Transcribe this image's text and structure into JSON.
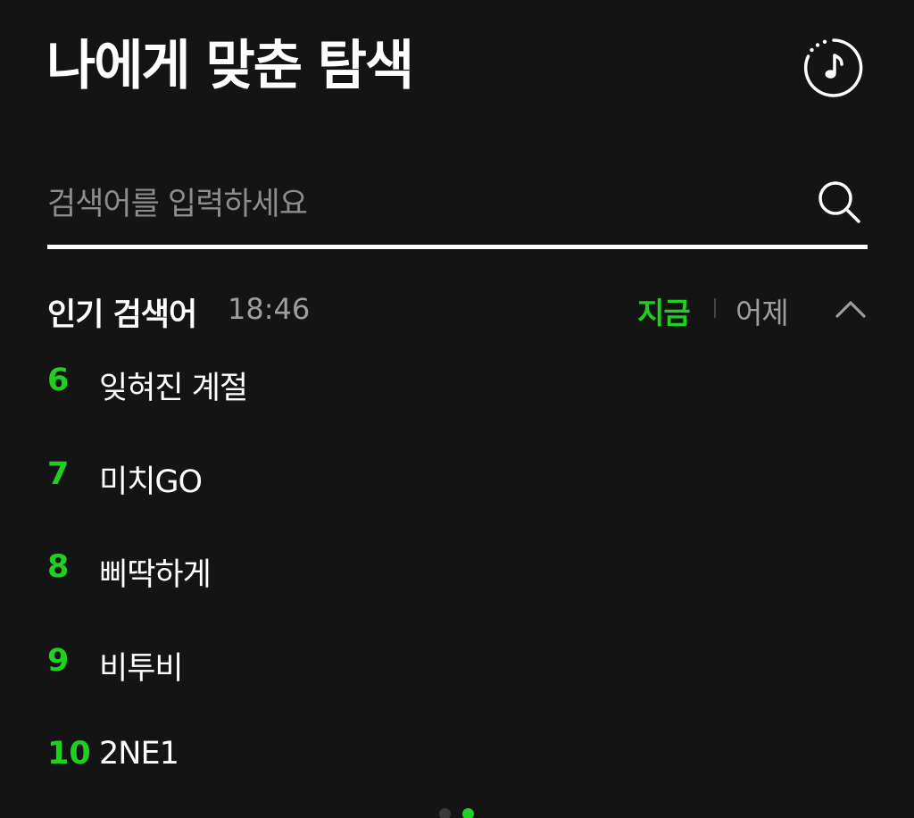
{
  "header": {
    "title": "나에게 맞춘 탐색",
    "music_icon": "music-note-circle-icon"
  },
  "search": {
    "placeholder": "검색어를 입력하세요",
    "value": "",
    "icon": "search-icon"
  },
  "popular": {
    "title": "인기 검색어",
    "time": "18:46",
    "tab_now": "지금",
    "tab_yesterday": "어제",
    "active_tab": "지금",
    "collapse_icon": "chevron-up-icon",
    "items": [
      {
        "rank": "6",
        "text": "잊혀진 계절"
      },
      {
        "rank": "7",
        "text": "미치GO"
      },
      {
        "rank": "8",
        "text": "삐딱하게"
      },
      {
        "rank": "9",
        "text": "비투비"
      },
      {
        "rank": "10",
        "text": "2NE1"
      }
    ]
  },
  "pager": {
    "pages": 2,
    "active_page": 2
  },
  "colors": {
    "background": "#141414",
    "accent": "#1ed11e",
    "muted": "#9e9e9e",
    "text": "#ffffff"
  }
}
